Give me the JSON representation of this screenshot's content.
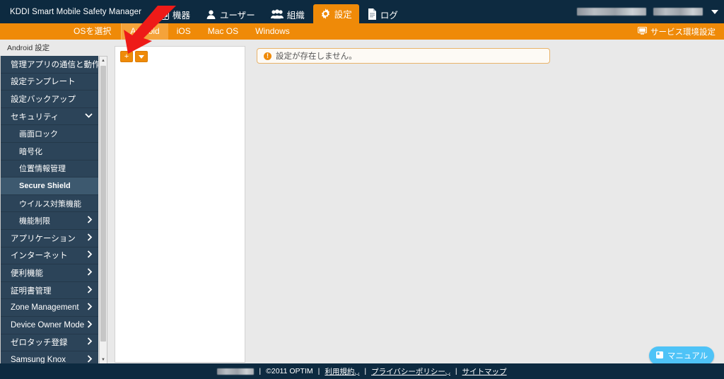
{
  "header": {
    "brand": "KDDI Smart Mobile Safety Manager",
    "nav": [
      {
        "label": "機器",
        "icon": "phone-icon",
        "active": false
      },
      {
        "label": "ユーザー",
        "icon": "user-icon",
        "active": false
      },
      {
        "label": "組織",
        "icon": "group-icon",
        "active": false
      },
      {
        "label": "設定",
        "icon": "gear-icon",
        "active": true
      },
      {
        "label": "ログ",
        "icon": "document-icon",
        "active": false
      }
    ],
    "account_redacted_1": "",
    "account_redacted_2": "",
    "account_caret": "▼"
  },
  "osbar": {
    "select_label": "OSを選択",
    "tabs": [
      {
        "label": "Android",
        "active": true
      },
      {
        "label": "iOS",
        "active": false
      },
      {
        "label": "Mac OS",
        "active": false
      },
      {
        "label": "Windows",
        "active": false
      }
    ],
    "service_env_label": "サービス環境設定",
    "service_env_icon": "monitor-icon"
  },
  "sidebar": {
    "title": "Android 設定",
    "items": [
      {
        "label": "管理アプリの通信と動作",
        "level": 0,
        "chevron": "",
        "active": false
      },
      {
        "label": "設定テンプレート",
        "level": 0,
        "chevron": "",
        "active": false
      },
      {
        "label": "設定バックアップ",
        "level": 0,
        "chevron": "",
        "active": false
      },
      {
        "label": "セキュリティ",
        "level": 0,
        "chevron": "⌄",
        "active": false
      },
      {
        "label": "画面ロック",
        "level": 1,
        "chevron": "",
        "active": false
      },
      {
        "label": "暗号化",
        "level": 1,
        "chevron": "",
        "active": false
      },
      {
        "label": "位置情報管理",
        "level": 1,
        "chevron": "",
        "active": false
      },
      {
        "label": "Secure Shield",
        "level": 1,
        "chevron": "",
        "active": true
      },
      {
        "label": "ウイルス対策機能",
        "level": 1,
        "chevron": "",
        "active": false
      },
      {
        "label": "機能制限",
        "level": 1,
        "chevron": "›",
        "active": false
      },
      {
        "label": "アプリケーション",
        "level": 0,
        "chevron": "›",
        "active": false
      },
      {
        "label": "インターネット",
        "level": 0,
        "chevron": "›",
        "active": false
      },
      {
        "label": "便利機能",
        "level": 0,
        "chevron": "›",
        "active": false
      },
      {
        "label": "証明書管理",
        "level": 0,
        "chevron": "›",
        "active": false
      },
      {
        "label": "Zone Management",
        "level": 0,
        "chevron": "›",
        "active": false
      },
      {
        "label": "Device Owner Mode",
        "level": 0,
        "chevron": "›",
        "active": false
      },
      {
        "label": "ゼロタッチ登録",
        "level": 0,
        "chevron": "›",
        "active": false
      },
      {
        "label": "Samsung Knox",
        "level": 0,
        "chevron": "›",
        "active": false
      }
    ],
    "scrollbar": {
      "up_arrow": "▲",
      "down_arrow": "▼"
    }
  },
  "tree_panel": {
    "add_button_label": "+",
    "dropdown_button_label": "▼"
  },
  "message": {
    "icon": "info-icon",
    "icon_glyph": "!",
    "text": "設定が存在しません。"
  },
  "manual_button": {
    "label": "マニュアル",
    "icon": "book-icon"
  },
  "footer": {
    "redacted": "",
    "copyright": "©2011 OPTIM",
    "links": [
      {
        "label": "利用規約",
        "external": true
      },
      {
        "label": "プライバシーポリシー",
        "external": true
      },
      {
        "label": "サイトマップ",
        "external": false
      }
    ],
    "separator": "|"
  },
  "annotation": {
    "type": "red-arrow",
    "color": "#ee1b18",
    "points_to": "add-button"
  },
  "colors": {
    "header_bg": "#0d2a40",
    "accent_orange": "#ef8a08",
    "sidebar_bg": "#2c4459",
    "sidebar_active": "#3d596f",
    "manual_blue": "#4ec3f7",
    "page_bg": "#e9e9e9"
  }
}
